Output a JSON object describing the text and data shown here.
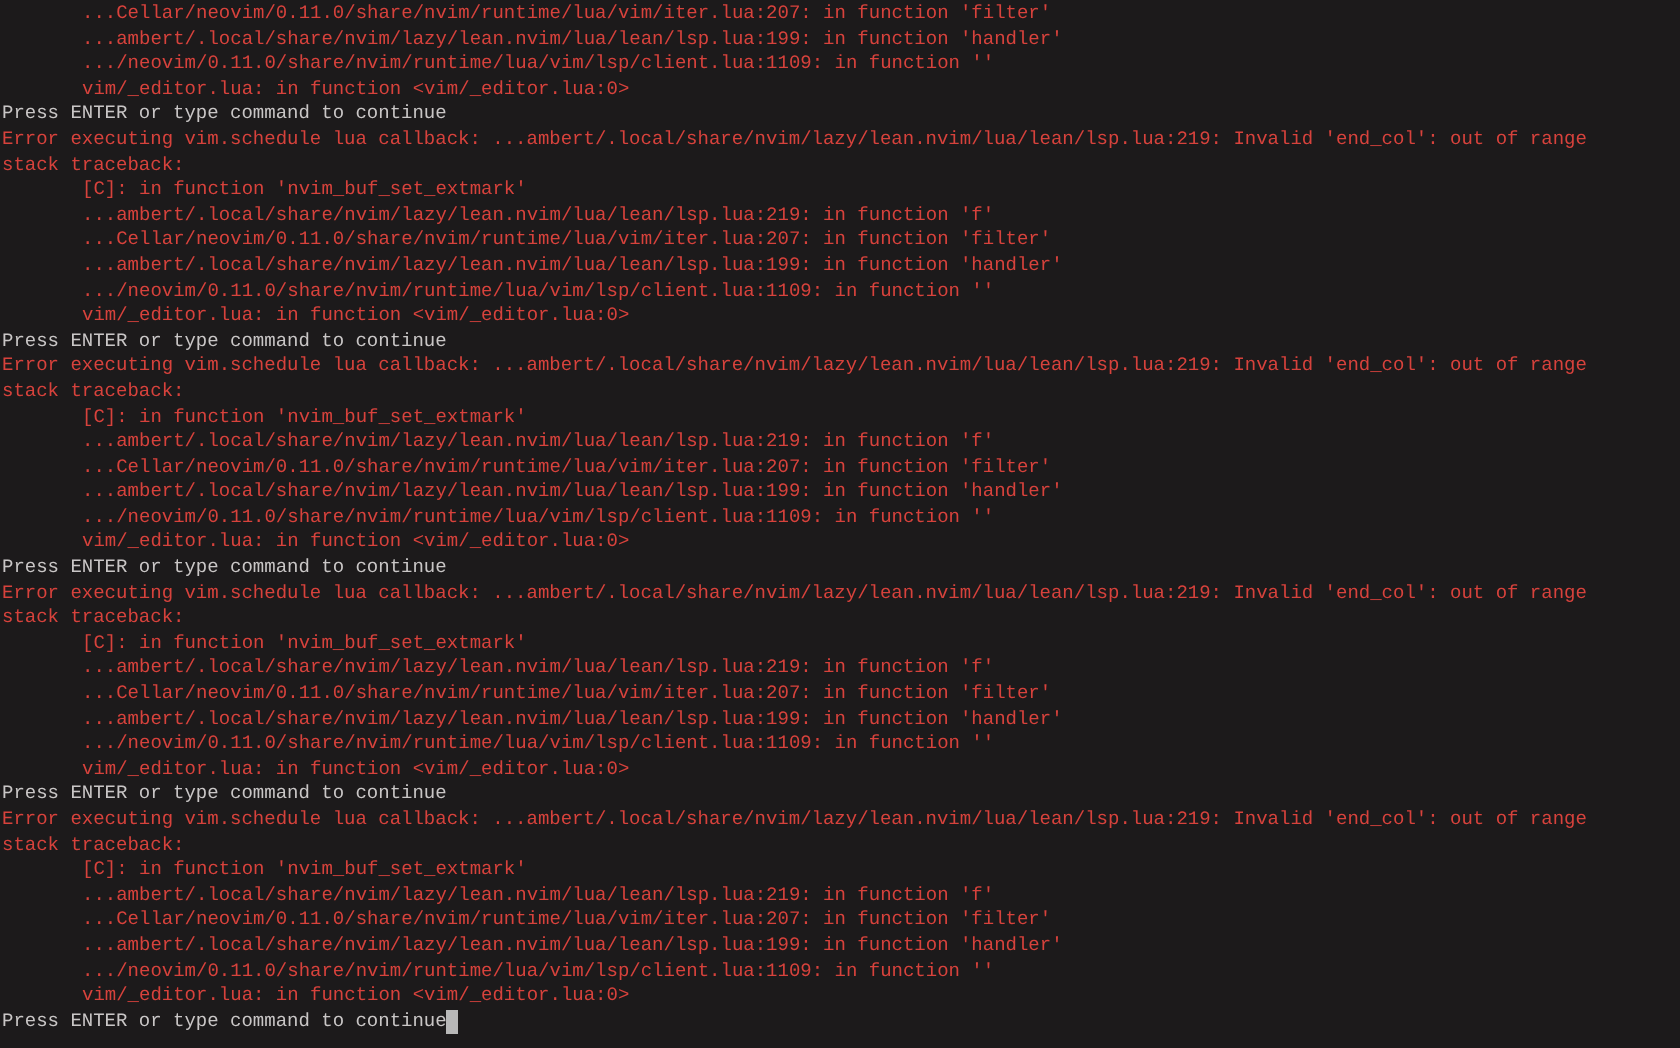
{
  "terminal": {
    "lines": [
      {
        "kind": "trace",
        "text": "...Cellar/neovim/0.11.0/share/nvim/runtime/lua/vim/iter.lua:207: in function 'filter'"
      },
      {
        "kind": "trace",
        "text": "...ambert/.local/share/nvim/lazy/lean.nvim/lua/lean/lsp.lua:199: in function 'handler'"
      },
      {
        "kind": "trace",
        "text": ".../neovim/0.11.0/share/nvim/runtime/lua/vim/lsp/client.lua:1109: in function ''"
      },
      {
        "kind": "trace",
        "text": "vim/_editor.lua: in function <vim/_editor.lua:0>"
      },
      {
        "kind": "prompt",
        "text": "Press ENTER or type command to continue",
        "cursor": false
      },
      {
        "kind": "error",
        "text": "Error executing vim.schedule lua callback: ...ambert/.local/share/nvim/lazy/lean.nvim/lua/lean/lsp.lua:219: Invalid 'end_col': out of range"
      },
      {
        "kind": "error",
        "text": "stack traceback:"
      },
      {
        "kind": "trace",
        "text": "[C]: in function 'nvim_buf_set_extmark'"
      },
      {
        "kind": "trace",
        "text": "...ambert/.local/share/nvim/lazy/lean.nvim/lua/lean/lsp.lua:219: in function 'f'"
      },
      {
        "kind": "trace",
        "text": "...Cellar/neovim/0.11.0/share/nvim/runtime/lua/vim/iter.lua:207: in function 'filter'"
      },
      {
        "kind": "trace",
        "text": "...ambert/.local/share/nvim/lazy/lean.nvim/lua/lean/lsp.lua:199: in function 'handler'"
      },
      {
        "kind": "trace",
        "text": ".../neovim/0.11.0/share/nvim/runtime/lua/vim/lsp/client.lua:1109: in function ''"
      },
      {
        "kind": "trace",
        "text": "vim/_editor.lua: in function <vim/_editor.lua:0>"
      },
      {
        "kind": "prompt",
        "text": "Press ENTER or type command to continue",
        "cursor": false
      },
      {
        "kind": "error",
        "text": "Error executing vim.schedule lua callback: ...ambert/.local/share/nvim/lazy/lean.nvim/lua/lean/lsp.lua:219: Invalid 'end_col': out of range"
      },
      {
        "kind": "error",
        "text": "stack traceback:"
      },
      {
        "kind": "trace",
        "text": "[C]: in function 'nvim_buf_set_extmark'"
      },
      {
        "kind": "trace",
        "text": "...ambert/.local/share/nvim/lazy/lean.nvim/lua/lean/lsp.lua:219: in function 'f'"
      },
      {
        "kind": "trace",
        "text": "...Cellar/neovim/0.11.0/share/nvim/runtime/lua/vim/iter.lua:207: in function 'filter'"
      },
      {
        "kind": "trace",
        "text": "...ambert/.local/share/nvim/lazy/lean.nvim/lua/lean/lsp.lua:199: in function 'handler'"
      },
      {
        "kind": "trace",
        "text": ".../neovim/0.11.0/share/nvim/runtime/lua/vim/lsp/client.lua:1109: in function ''"
      },
      {
        "kind": "trace",
        "text": "vim/_editor.lua: in function <vim/_editor.lua:0>"
      },
      {
        "kind": "prompt",
        "text": "Press ENTER or type command to continue",
        "cursor": false
      },
      {
        "kind": "error",
        "text": "Error executing vim.schedule lua callback: ...ambert/.local/share/nvim/lazy/lean.nvim/lua/lean/lsp.lua:219: Invalid 'end_col': out of range"
      },
      {
        "kind": "error",
        "text": "stack traceback:"
      },
      {
        "kind": "trace",
        "text": "[C]: in function 'nvim_buf_set_extmark'"
      },
      {
        "kind": "trace",
        "text": "...ambert/.local/share/nvim/lazy/lean.nvim/lua/lean/lsp.lua:219: in function 'f'"
      },
      {
        "kind": "trace",
        "text": "...Cellar/neovim/0.11.0/share/nvim/runtime/lua/vim/iter.lua:207: in function 'filter'"
      },
      {
        "kind": "trace",
        "text": "...ambert/.local/share/nvim/lazy/lean.nvim/lua/lean/lsp.lua:199: in function 'handler'"
      },
      {
        "kind": "trace",
        "text": ".../neovim/0.11.0/share/nvim/runtime/lua/vim/lsp/client.lua:1109: in function ''"
      },
      {
        "kind": "trace",
        "text": "vim/_editor.lua: in function <vim/_editor.lua:0>"
      },
      {
        "kind": "prompt",
        "text": "Press ENTER or type command to continue",
        "cursor": false
      },
      {
        "kind": "error",
        "text": "Error executing vim.schedule lua callback: ...ambert/.local/share/nvim/lazy/lean.nvim/lua/lean/lsp.lua:219: Invalid 'end_col': out of range"
      },
      {
        "kind": "error",
        "text": "stack traceback:"
      },
      {
        "kind": "trace",
        "text": "[C]: in function 'nvim_buf_set_extmark'"
      },
      {
        "kind": "trace",
        "text": "...ambert/.local/share/nvim/lazy/lean.nvim/lua/lean/lsp.lua:219: in function 'f'"
      },
      {
        "kind": "trace",
        "text": "...Cellar/neovim/0.11.0/share/nvim/runtime/lua/vim/iter.lua:207: in function 'filter'"
      },
      {
        "kind": "trace",
        "text": "...ambert/.local/share/nvim/lazy/lean.nvim/lua/lean/lsp.lua:199: in function 'handler'"
      },
      {
        "kind": "trace",
        "text": ".../neovim/0.11.0/share/nvim/runtime/lua/vim/lsp/client.lua:1109: in function ''"
      },
      {
        "kind": "trace",
        "text": "vim/_editor.lua: in function <vim/_editor.lua:0>"
      },
      {
        "kind": "prompt",
        "text": "Press ENTER or type command to continue",
        "cursor": true
      }
    ]
  }
}
